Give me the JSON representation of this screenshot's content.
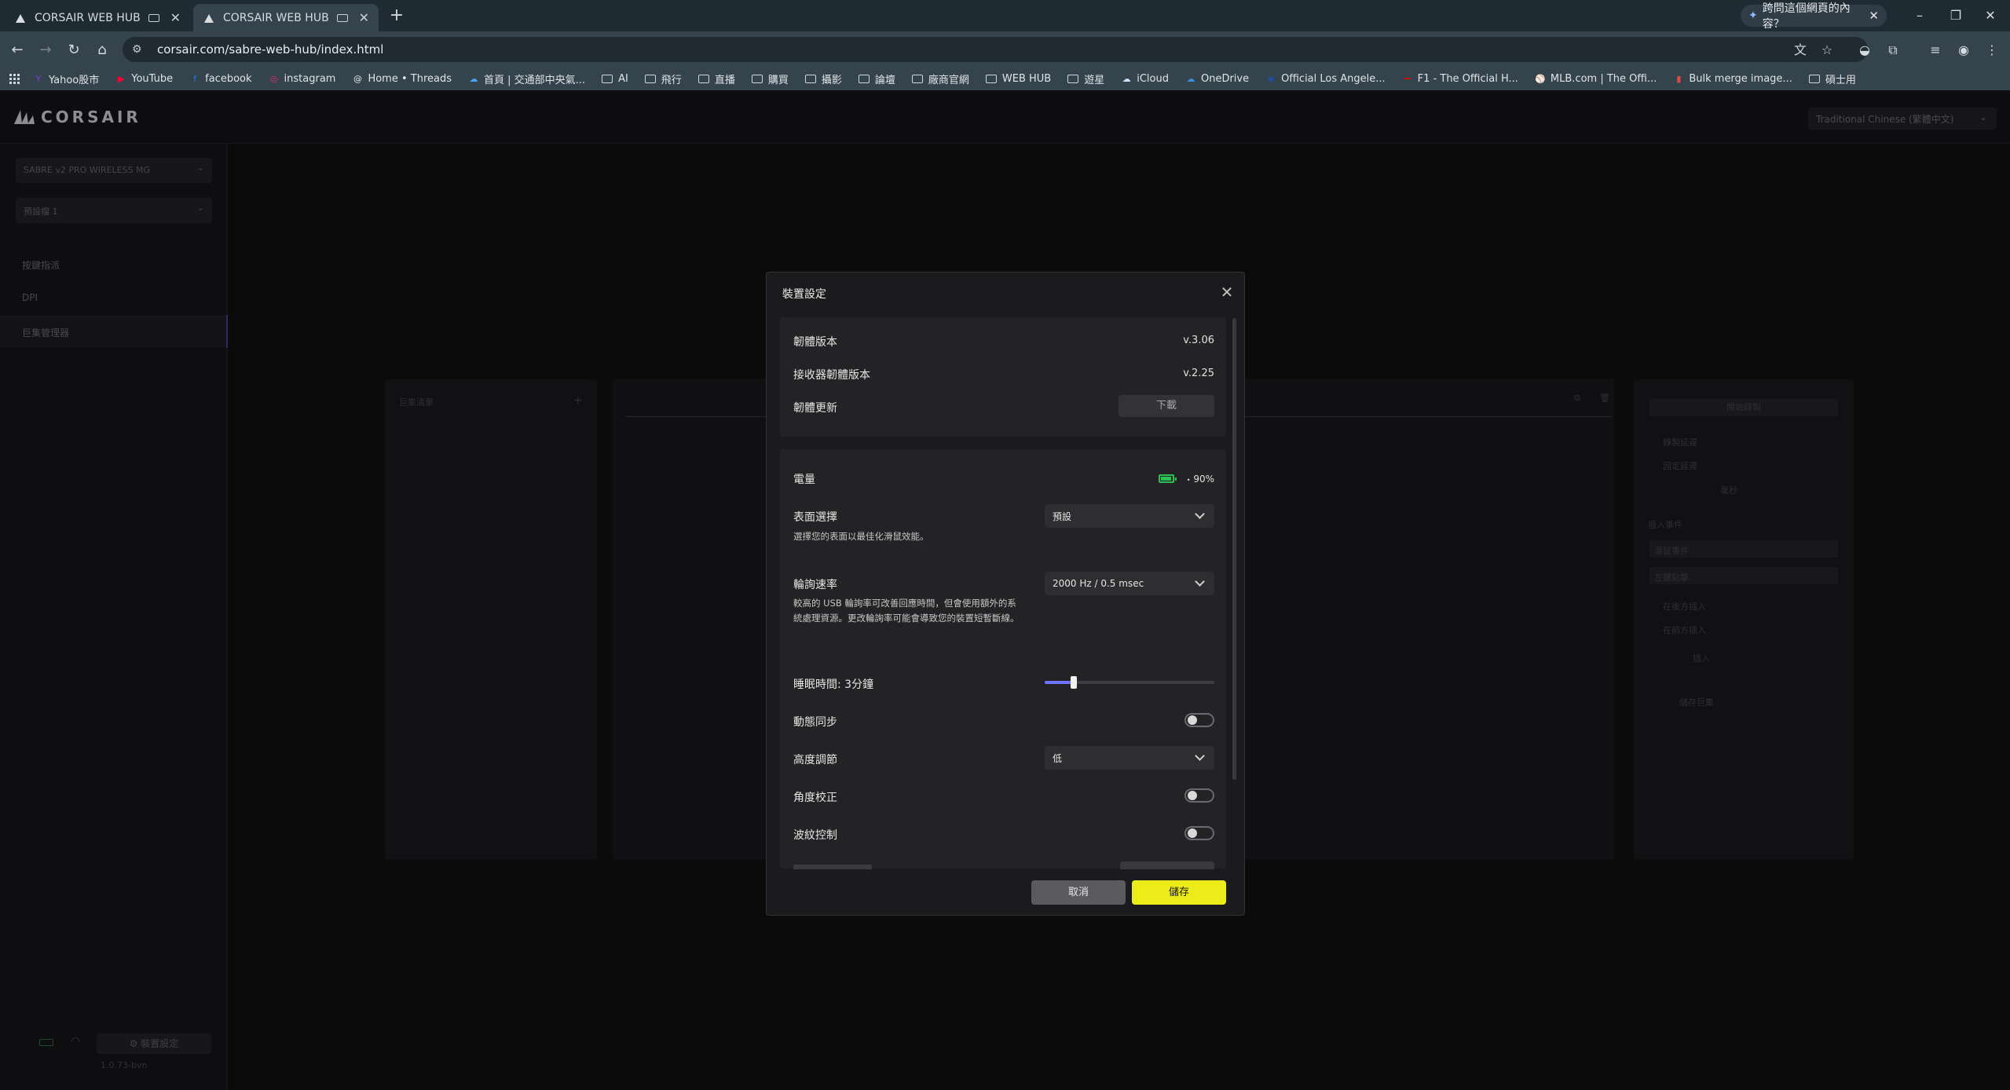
{
  "browser": {
    "tabs": [
      {
        "title": "CORSAIR WEB HUB",
        "active": false
      },
      {
        "title": "CORSAIR WEB HUB",
        "active": true
      }
    ],
    "ask_page": "跨問這個網頁的內容？",
    "url": "corsair.com/sabre-web-hub/index.html",
    "bookmarks": [
      {
        "label": "Yahoo股市",
        "icon": "yahoo-icon",
        "type": "site"
      },
      {
        "label": "YouTube",
        "icon": "youtube-icon",
        "type": "site"
      },
      {
        "label": "facebook",
        "icon": "facebook-icon",
        "type": "site"
      },
      {
        "label": "instagram",
        "icon": "instagram-icon",
        "type": "site"
      },
      {
        "label": "Home • Threads",
        "icon": "threads-icon",
        "type": "site"
      },
      {
        "label": "首頁 | 交通部中央氣...",
        "icon": "weather-icon",
        "type": "site"
      },
      {
        "label": "AI",
        "icon": "folder-icon",
        "type": "folder"
      },
      {
        "label": "飛行",
        "icon": "folder-icon",
        "type": "folder"
      },
      {
        "label": "直播",
        "icon": "folder-icon",
        "type": "folder"
      },
      {
        "label": "購買",
        "icon": "folder-icon",
        "type": "folder"
      },
      {
        "label": "攝影",
        "icon": "folder-icon",
        "type": "folder"
      },
      {
        "label": "論壇",
        "icon": "folder-icon",
        "type": "folder"
      },
      {
        "label": "廠商官網",
        "icon": "folder-icon",
        "type": "folder"
      },
      {
        "label": "WEB HUB",
        "icon": "folder-icon",
        "type": "folder"
      },
      {
        "label": "遊星",
        "icon": "folder-icon",
        "type": "folder"
      },
      {
        "label": "iCloud",
        "icon": "icloud-icon",
        "type": "site"
      },
      {
        "label": "OneDrive",
        "icon": "onedrive-icon",
        "type": "site"
      },
      {
        "label": "Official Los Angele...",
        "icon": "dodgers-icon",
        "type": "site"
      },
      {
        "label": "F1 - The Official H...",
        "icon": "f1-icon",
        "type": "site"
      },
      {
        "label": "MLB.com | The Offi...",
        "icon": "mlb-icon",
        "type": "site"
      },
      {
        "label": "Bulk merge image...",
        "icon": "pdf-icon",
        "type": "site"
      },
      {
        "label": "碩士用",
        "icon": "folder-icon",
        "type": "folder"
      }
    ]
  },
  "app": {
    "logo": "CORSAIR",
    "language": "Traditional Chinese (繁體中文)",
    "sidebar": {
      "device": "SABRE v2 PRO WIRELESS MG",
      "profile": "預設檔 1",
      "items": [
        "按鍵指派",
        "DPI",
        "巨集管理器"
      ],
      "device_settings": "裝置設定",
      "firmware": "1.0.73-bvn"
    },
    "background": {
      "macro_list": "巨集清單",
      "record_delay": "錄製延遲",
      "fixed_delay": "固定延遲",
      "ms": "毫秒",
      "insert_event": "插入事件",
      "mouse_event": "滑鼠事件",
      "left_click": "左鍵點擊",
      "insert_below": "在後方插入",
      "insert_above": "在前方插入",
      "insert": "插入",
      "save_macro": "儲存巨集",
      "start_record": "開始錄製"
    }
  },
  "modal": {
    "title": "裝置設定",
    "firmware_version_label": "韌體版本",
    "firmware_version": "v.3.06",
    "receiver_firmware_label": "接收器韌體版本",
    "receiver_firmware": "v.2.25",
    "firmware_update_label": "韌體更新",
    "download_label": "下載",
    "battery_label": "電量",
    "battery_percent": "90%",
    "battery_level": 0.9,
    "battery_color": "#2bbf55",
    "surface_label": "表面選擇",
    "surface_value": "預設",
    "surface_desc": "選擇您的表面以最佳化滑鼠效能。",
    "polling_label": "輪詢速率",
    "polling_value": "2000 Hz / 0.5 msec",
    "polling_desc_1": "較高的 USB 輪詢率可改善回應時間，但會使用額外的系",
    "polling_desc_2": "統處理資源。更改輪詢率可能會導致您的裝置短暫斷線。",
    "sleep_label": "睡眠時間: 3分鐘",
    "sleep_fraction": 0.17,
    "slider_color": "#6f73ff",
    "motion_sync_label": "動態同步",
    "lift_height_label": "高度調節",
    "lift_height_value": "低",
    "angle_snap_label": "角度校正",
    "ripple_label": "波紋控制",
    "cancel_label": "取消",
    "save_label": "儲存",
    "save_color": "#ecec1a"
  }
}
